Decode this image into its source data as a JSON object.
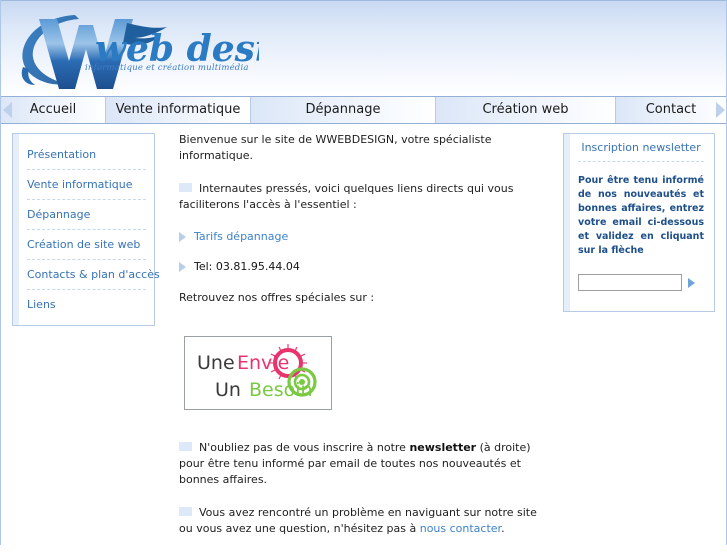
{
  "header": {
    "logo_text": "Wweb design",
    "logo_w": "W",
    "logo_rest": "web design",
    "tagline": "informatique et création multimédia"
  },
  "nav": {
    "items": [
      {
        "label": "Accueil"
      },
      {
        "label": "Vente informatique"
      },
      {
        "label": "Dépannage"
      },
      {
        "label": "Création web"
      },
      {
        "label": "Contact"
      }
    ]
  },
  "sidebar": {
    "items": [
      {
        "label": "Présentation"
      },
      {
        "label": "Vente informatique"
      },
      {
        "label": "Dépannage"
      },
      {
        "label": "Création de site web"
      },
      {
        "label": "Contacts & plan d'accès"
      },
      {
        "label": "Liens"
      }
    ]
  },
  "main": {
    "intro": "Bienvenue sur le site de WWEBDESIGN, votre spécialiste informatique.",
    "para_quick_1": "Internautes pressés, voici quelques liens directs qui vous faciliterons",
    "para_quick_2": "l'accès à l'essentiel :",
    "quick_links": [
      {
        "label": "Tarifs dépannage",
        "type": "link"
      },
      {
        "label": "Tel: 03.81.95.44.04",
        "type": "text"
      }
    ],
    "offers_line": "Retrouvez nos offres spéciales sur :",
    "banner": {
      "line1_a": "Une ",
      "line1_b": "Envie",
      "line2_a": "Un ",
      "line2_b": "Besoin"
    },
    "para_news_a": "N'oubliez pas de vous inscrire à notre ",
    "para_news_bold": "newsletter",
    "para_news_b": " (à droite) pour être tenu informé par email de toutes nos nouveautés et bonnes affaires.",
    "para_contact_a": "Vous avez rencontré un problème en naviguant sur notre site ou vous avez une question, n'hésitez pas à ",
    "para_contact_link": "nous contacter",
    "para_contact_b": "."
  },
  "newsletter": {
    "title": "Inscription newsletter",
    "body": "Pour être tenu informé de nos nouveautés et bonnes affaires, entrez votre email ci-dessous et validez en cliquant sur la flèche",
    "input_value": "",
    "input_placeholder": "",
    "submit_icon": "triangle-right-icon"
  },
  "colors": {
    "accent_blue": "#3773b5",
    "link_blue": "#3e82c8",
    "header_blue": "#c9d9f2",
    "border_blue": "#b7cbe7",
    "banner_pink": "#e8336d",
    "banner_green": "#7ac943"
  }
}
